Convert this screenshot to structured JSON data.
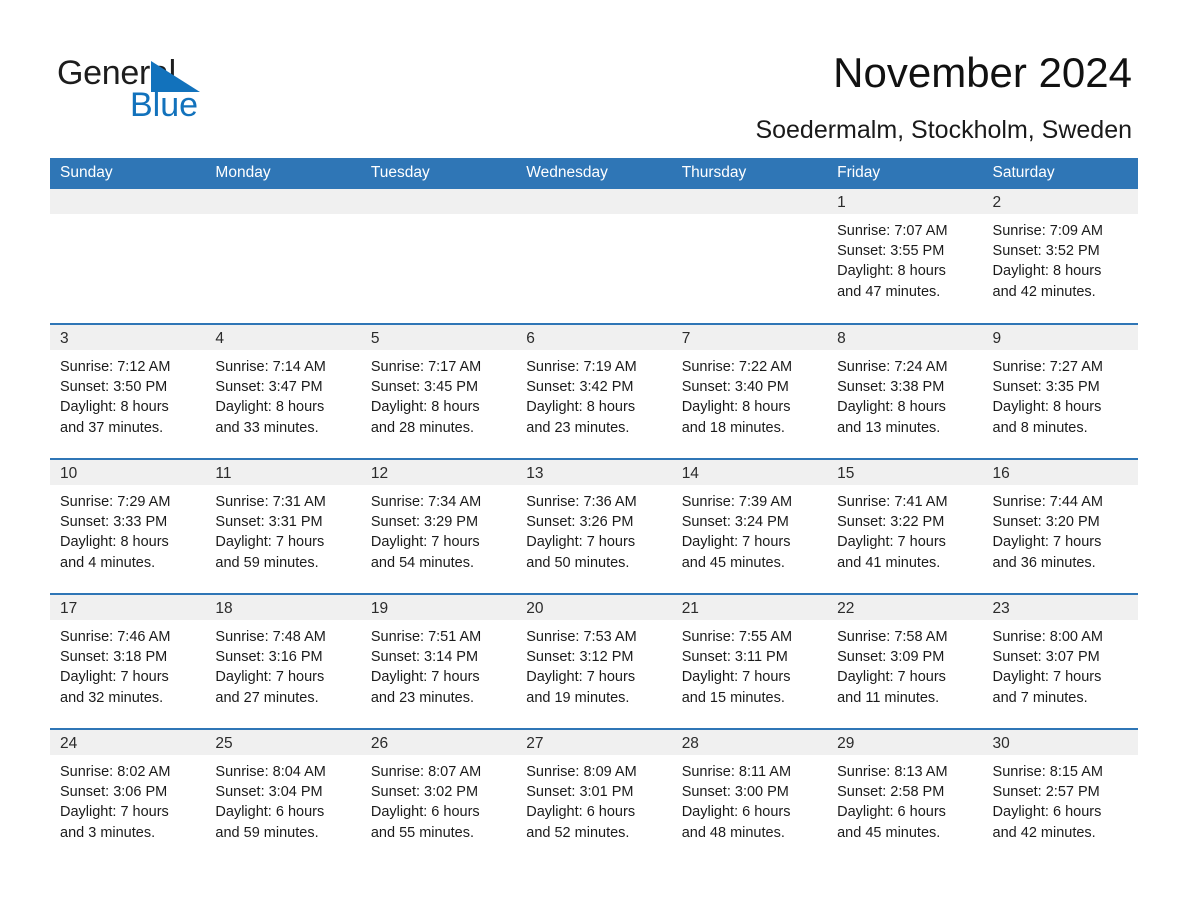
{
  "brand": {
    "name_part1": "General",
    "name_part2": "Blue",
    "triangle_color": "#1272bc"
  },
  "header": {
    "month_title": "November 2024",
    "location": "Soedermalm, Stockholm, Sweden"
  },
  "colors": {
    "header_blue": "#2f76b6",
    "row_divider_blue": "#2f76b6",
    "date_band_gray": "#f0f0f0",
    "text": "#1b1b1b"
  },
  "weekday_headers": [
    "Sunday",
    "Monday",
    "Tuesday",
    "Wednesday",
    "Thursday",
    "Friday",
    "Saturday"
  ],
  "weeks": [
    [
      {
        "date": "",
        "empty": true,
        "lines": []
      },
      {
        "date": "",
        "empty": true,
        "lines": []
      },
      {
        "date": "",
        "empty": true,
        "lines": []
      },
      {
        "date": "",
        "empty": true,
        "lines": []
      },
      {
        "date": "",
        "empty": true,
        "lines": []
      },
      {
        "date": "1",
        "empty": false,
        "lines": [
          "Sunrise: 7:07 AM",
          "Sunset: 3:55 PM",
          "Daylight: 8 hours",
          "and 47 minutes."
        ]
      },
      {
        "date": "2",
        "empty": false,
        "lines": [
          "Sunrise: 7:09 AM",
          "Sunset: 3:52 PM",
          "Daylight: 8 hours",
          "and 42 minutes."
        ]
      }
    ],
    [
      {
        "date": "3",
        "empty": false,
        "lines": [
          "Sunrise: 7:12 AM",
          "Sunset: 3:50 PM",
          "Daylight: 8 hours",
          "and 37 minutes."
        ]
      },
      {
        "date": "4",
        "empty": false,
        "lines": [
          "Sunrise: 7:14 AM",
          "Sunset: 3:47 PM",
          "Daylight: 8 hours",
          "and 33 minutes."
        ]
      },
      {
        "date": "5",
        "empty": false,
        "lines": [
          "Sunrise: 7:17 AM",
          "Sunset: 3:45 PM",
          "Daylight: 8 hours",
          "and 28 minutes."
        ]
      },
      {
        "date": "6",
        "empty": false,
        "lines": [
          "Sunrise: 7:19 AM",
          "Sunset: 3:42 PM",
          "Daylight: 8 hours",
          "and 23 minutes."
        ]
      },
      {
        "date": "7",
        "empty": false,
        "lines": [
          "Sunrise: 7:22 AM",
          "Sunset: 3:40 PM",
          "Daylight: 8 hours",
          "and 18 minutes."
        ]
      },
      {
        "date": "8",
        "empty": false,
        "lines": [
          "Sunrise: 7:24 AM",
          "Sunset: 3:38 PM",
          "Daylight: 8 hours",
          "and 13 minutes."
        ]
      },
      {
        "date": "9",
        "empty": false,
        "lines": [
          "Sunrise: 7:27 AM",
          "Sunset: 3:35 PM",
          "Daylight: 8 hours",
          "and 8 minutes."
        ]
      }
    ],
    [
      {
        "date": "10",
        "empty": false,
        "lines": [
          "Sunrise: 7:29 AM",
          "Sunset: 3:33 PM",
          "Daylight: 8 hours",
          "and 4 minutes."
        ]
      },
      {
        "date": "11",
        "empty": false,
        "lines": [
          "Sunrise: 7:31 AM",
          "Sunset: 3:31 PM",
          "Daylight: 7 hours",
          "and 59 minutes."
        ]
      },
      {
        "date": "12",
        "empty": false,
        "lines": [
          "Sunrise: 7:34 AM",
          "Sunset: 3:29 PM",
          "Daylight: 7 hours",
          "and 54 minutes."
        ]
      },
      {
        "date": "13",
        "empty": false,
        "lines": [
          "Sunrise: 7:36 AM",
          "Sunset: 3:26 PM",
          "Daylight: 7 hours",
          "and 50 minutes."
        ]
      },
      {
        "date": "14",
        "empty": false,
        "lines": [
          "Sunrise: 7:39 AM",
          "Sunset: 3:24 PM",
          "Daylight: 7 hours",
          "and 45 minutes."
        ]
      },
      {
        "date": "15",
        "empty": false,
        "lines": [
          "Sunrise: 7:41 AM",
          "Sunset: 3:22 PM",
          "Daylight: 7 hours",
          "and 41 minutes."
        ]
      },
      {
        "date": "16",
        "empty": false,
        "lines": [
          "Sunrise: 7:44 AM",
          "Sunset: 3:20 PM",
          "Daylight: 7 hours",
          "and 36 minutes."
        ]
      }
    ],
    [
      {
        "date": "17",
        "empty": false,
        "lines": [
          "Sunrise: 7:46 AM",
          "Sunset: 3:18 PM",
          "Daylight: 7 hours",
          "and 32 minutes."
        ]
      },
      {
        "date": "18",
        "empty": false,
        "lines": [
          "Sunrise: 7:48 AM",
          "Sunset: 3:16 PM",
          "Daylight: 7 hours",
          "and 27 minutes."
        ]
      },
      {
        "date": "19",
        "empty": false,
        "lines": [
          "Sunrise: 7:51 AM",
          "Sunset: 3:14 PM",
          "Daylight: 7 hours",
          "and 23 minutes."
        ]
      },
      {
        "date": "20",
        "empty": false,
        "lines": [
          "Sunrise: 7:53 AM",
          "Sunset: 3:12 PM",
          "Daylight: 7 hours",
          "and 19 minutes."
        ]
      },
      {
        "date": "21",
        "empty": false,
        "lines": [
          "Sunrise: 7:55 AM",
          "Sunset: 3:11 PM",
          "Daylight: 7 hours",
          "and 15 minutes."
        ]
      },
      {
        "date": "22",
        "empty": false,
        "lines": [
          "Sunrise: 7:58 AM",
          "Sunset: 3:09 PM",
          "Daylight: 7 hours",
          "and 11 minutes."
        ]
      },
      {
        "date": "23",
        "empty": false,
        "lines": [
          "Sunrise: 8:00 AM",
          "Sunset: 3:07 PM",
          "Daylight: 7 hours",
          "and 7 minutes."
        ]
      }
    ],
    [
      {
        "date": "24",
        "empty": false,
        "lines": [
          "Sunrise: 8:02 AM",
          "Sunset: 3:06 PM",
          "Daylight: 7 hours",
          "and 3 minutes."
        ]
      },
      {
        "date": "25",
        "empty": false,
        "lines": [
          "Sunrise: 8:04 AM",
          "Sunset: 3:04 PM",
          "Daylight: 6 hours",
          "and 59 minutes."
        ]
      },
      {
        "date": "26",
        "empty": false,
        "lines": [
          "Sunrise: 8:07 AM",
          "Sunset: 3:02 PM",
          "Daylight: 6 hours",
          "and 55 minutes."
        ]
      },
      {
        "date": "27",
        "empty": false,
        "lines": [
          "Sunrise: 8:09 AM",
          "Sunset: 3:01 PM",
          "Daylight: 6 hours",
          "and 52 minutes."
        ]
      },
      {
        "date": "28",
        "empty": false,
        "lines": [
          "Sunrise: 8:11 AM",
          "Sunset: 3:00 PM",
          "Daylight: 6 hours",
          "and 48 minutes."
        ]
      },
      {
        "date": "29",
        "empty": false,
        "lines": [
          "Sunrise: 8:13 AM",
          "Sunset: 2:58 PM",
          "Daylight: 6 hours",
          "and 45 minutes."
        ]
      },
      {
        "date": "30",
        "empty": false,
        "lines": [
          "Sunrise: 8:15 AM",
          "Sunset: 2:57 PM",
          "Daylight: 6 hours",
          "and 42 minutes."
        ]
      }
    ]
  ]
}
